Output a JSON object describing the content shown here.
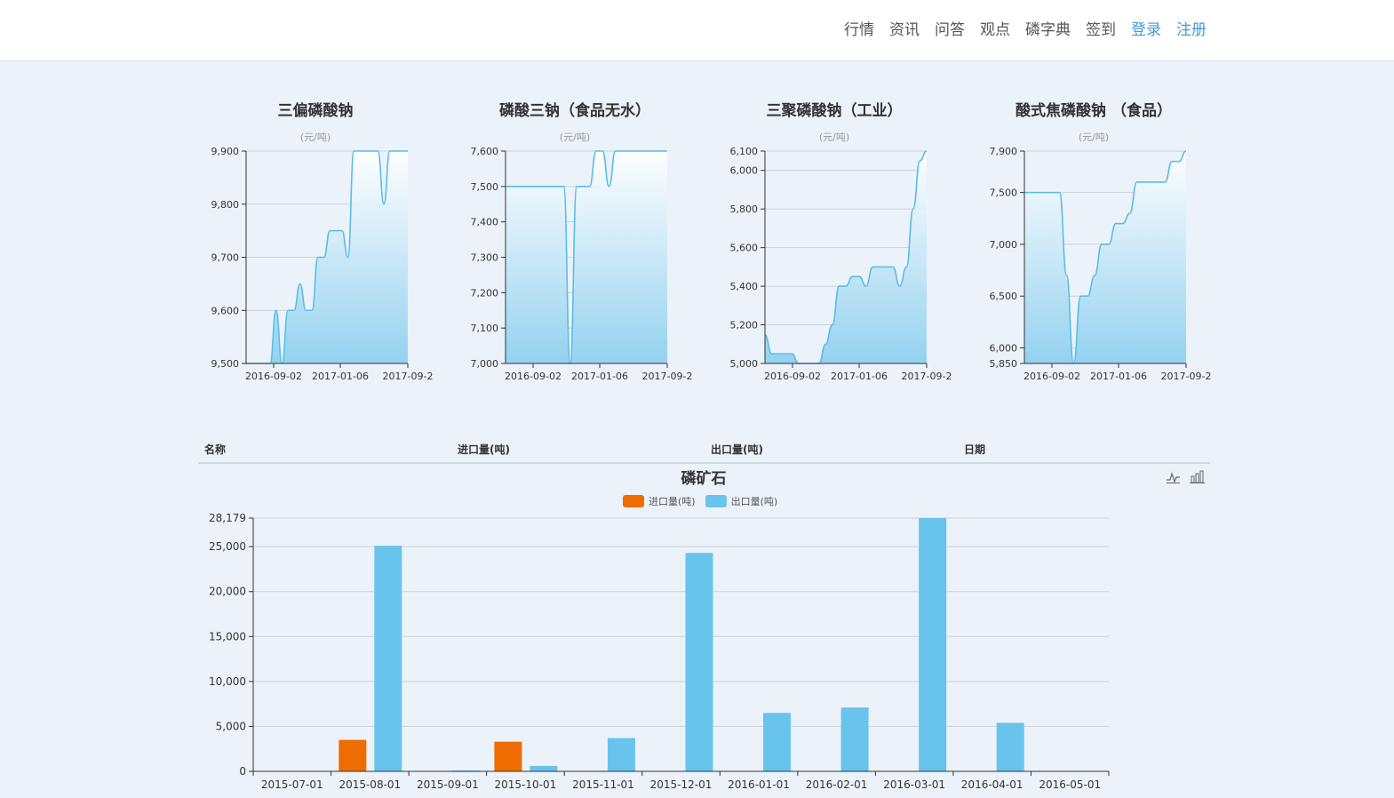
{
  "nav": {
    "items": [
      "行情",
      "资讯",
      "问答",
      "观点",
      "磷字典",
      "签到"
    ],
    "login": "登录",
    "register": "注册"
  },
  "colors": {
    "line": "#5bbde6",
    "import": "#ee6c00",
    "export": "#68c4ec",
    "link": "#3f9bd8"
  },
  "mini_charts": [
    {
      "title": "三偏磷酸钠",
      "unit": "(元/吨)",
      "chart_data": {
        "type": "area",
        "yticks": [
          9500,
          9600,
          9700,
          9800,
          9900
        ],
        "ylim": [
          9500,
          9900
        ],
        "xticks": [
          "2016-09-02",
          "2017-01-06",
          "2017-09-2"
        ],
        "values": [
          9500,
          9500,
          9500,
          9500,
          9500,
          9600,
          9500,
          9600,
          9600,
          9650,
          9600,
          9600,
          9700,
          9700,
          9750,
          9750,
          9750,
          9700,
          9900,
          9900,
          9900,
          9900,
          9900,
          9800,
          9900,
          9900,
          9900,
          9900
        ]
      }
    },
    {
      "title": "磷酸三钠（食品无水）",
      "unit": "(元/吨)",
      "chart_data": {
        "type": "area",
        "yticks": [
          7000,
          7100,
          7200,
          7300,
          7400,
          7500,
          7600
        ],
        "ylim": [
          7000,
          7600
        ],
        "xticks": [
          "2016-09-02",
          "2017-01-06",
          "2017-09-2"
        ],
        "values": [
          7500,
          7500,
          7500,
          7500,
          7500,
          7500,
          7500,
          7500,
          7500,
          7500,
          7000,
          7500,
          7500,
          7500,
          7600,
          7600,
          7500,
          7600,
          7600,
          7600,
          7600,
          7600,
          7600,
          7600,
          7600,
          7600
        ]
      }
    },
    {
      "title": "三聚磷酸钠（工业）",
      "unit": "(元/吨)",
      "chart_data": {
        "type": "area",
        "yticks": [
          5000,
          5200,
          5400,
          5600,
          5800,
          6000,
          6100
        ],
        "ylim": [
          5000,
          6100
        ],
        "xticks": [
          "2016-09-02",
          "2017-01-06",
          "2017-09-2"
        ],
        "values": [
          5150,
          5050,
          5050,
          5050,
          5050,
          5000,
          5000,
          5000,
          5000,
          5100,
          5200,
          5400,
          5400,
          5450,
          5450,
          5400,
          5500,
          5500,
          5500,
          5500,
          5400,
          5500,
          5800,
          6050,
          6100
        ]
      }
    },
    {
      "title": "酸式焦磷酸钠 （食品）",
      "unit": "(元/吨)",
      "chart_data": {
        "type": "area",
        "yticks": [
          5850,
          6000,
          6500,
          7000,
          7500,
          7900
        ],
        "ylim": [
          5850,
          7900
        ],
        "xticks": [
          "2016-09-02",
          "2017-01-06",
          "2017-09-2"
        ],
        "values": [
          7500,
          7500,
          7500,
          7500,
          7500,
          7500,
          6700,
          5850,
          6500,
          6500,
          6700,
          7000,
          7000,
          7200,
          7200,
          7300,
          7600,
          7600,
          7600,
          7600,
          7600,
          7800,
          7800,
          7900
        ]
      }
    }
  ],
  "table": {
    "headers": [
      "名称",
      "进口量(吨)",
      "出口量(吨)",
      "日期"
    ]
  },
  "main_chart": {
    "title": "磷矿石",
    "chart_data": {
      "type": "bar",
      "categories": [
        "2015-07-01",
        "2015-08-01",
        "2015-09-01",
        "2015-10-01",
        "2015-11-01",
        "2015-12-01",
        "2016-01-01",
        "2016-02-01",
        "2016-03-01",
        "2016-04-01",
        "2016-05-01"
      ],
      "series": [
        {
          "name": "进口量(吨)",
          "values": [
            0,
            3500,
            0,
            3300,
            0,
            0,
            0,
            0,
            0,
            0,
            0
          ]
        },
        {
          "name": "出口量(吨)",
          "values": [
            0,
            25100,
            100,
            600,
            3700,
            24300,
            6500,
            7100,
            28179,
            5400,
            0
          ]
        }
      ],
      "yticks": [
        0,
        5000,
        10000,
        15000,
        20000,
        25000,
        28179
      ],
      "ylim": [
        0,
        28179
      ]
    },
    "tools": [
      "line-chart-icon",
      "bar-chart-icon"
    ]
  }
}
